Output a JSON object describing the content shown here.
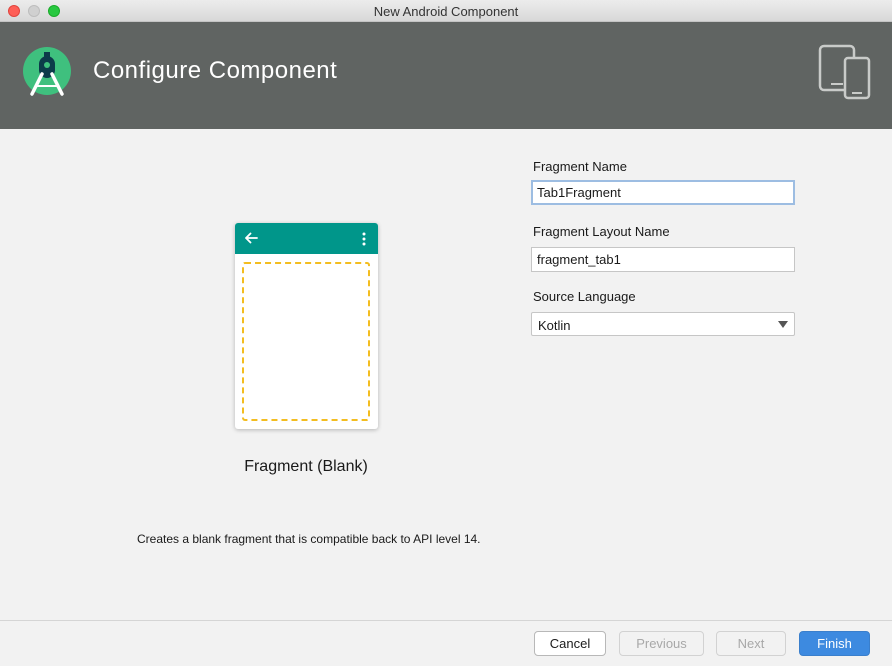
{
  "window": {
    "title": "New Android Component"
  },
  "header": {
    "title": "Configure Component",
    "logo_icon": "android-studio-logo",
    "devices_icon": "tablet-phone-icon",
    "background_color": "#606462"
  },
  "preview": {
    "appbar_color": "#00968a",
    "placeholder_border_color": "#f3bd20",
    "template_name": "Fragment (Blank)",
    "description": "Creates a blank fragment that is compatible back to API level 14."
  },
  "form": {
    "fragment_name": {
      "label": "Fragment Name",
      "value": "Tab1Fragment"
    },
    "fragment_layout_name": {
      "label": "Fragment Layout Name",
      "value": "fragment_tab1"
    },
    "source_language": {
      "label": "Source Language",
      "value": "Kotlin"
    }
  },
  "footer": {
    "cancel_label": "Cancel",
    "previous_label": "Previous",
    "next_label": "Next",
    "finish_label": "Finish",
    "primary_color": "#3d8ae0"
  }
}
